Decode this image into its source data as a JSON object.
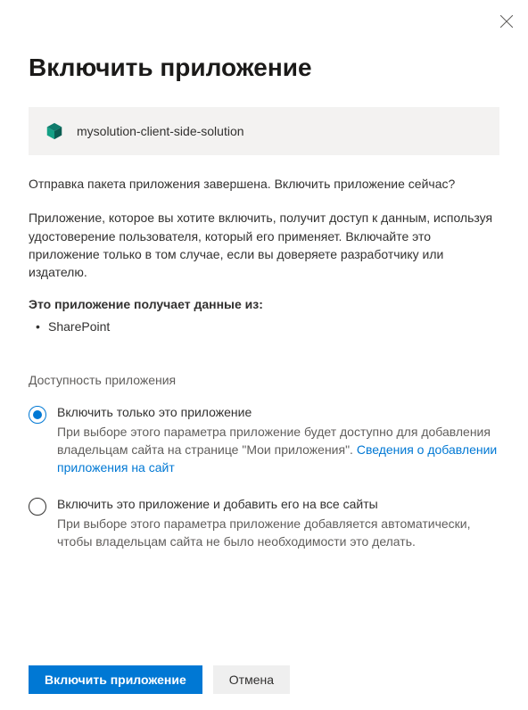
{
  "dialog": {
    "title": "Включить приложение",
    "app_name": "mysolution-client-side-solution",
    "intro": "Отправка пакета приложения завершена. Включить приложение сейчас?",
    "description": "Приложение, которое вы хотите включить, получит доступ к данным, используя удостоверение пользователя, который его применяет. Включайте это приложение только в том случае, если вы доверяете разработчику или издателю.",
    "data_heading": "Это приложение получает данные из:",
    "data_sources": [
      "SharePoint"
    ],
    "availability_heading": "Доступность приложения",
    "options": [
      {
        "label": "Включить только это приложение",
        "desc_prefix": "При выборе этого параметра приложение будет доступно для добавления владельцам сайта на странице \"Мои приложения\". ",
        "link": "Сведения о добавлении приложения на сайт",
        "selected": true
      },
      {
        "label": "Включить это приложение и добавить его на все сайты",
        "desc": "При выборе этого параметра приложение добавляется автоматически, чтобы владельцам сайта не было необходимости это делать.",
        "selected": false
      }
    ],
    "buttons": {
      "primary": "Включить приложение",
      "secondary": "Отмена"
    }
  }
}
